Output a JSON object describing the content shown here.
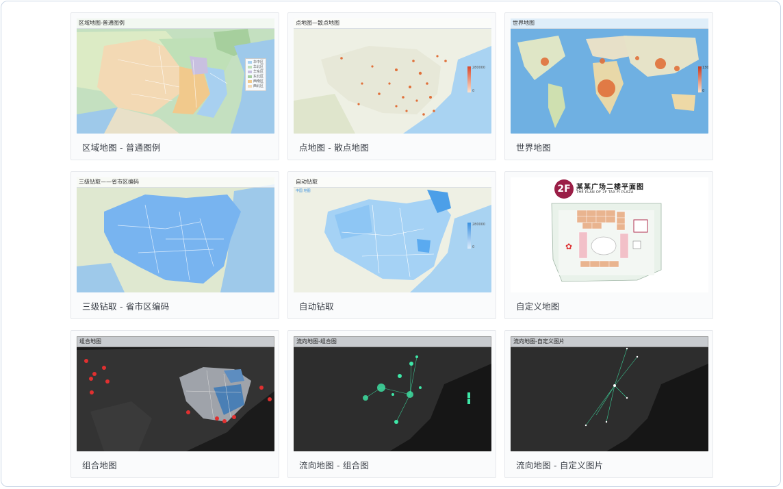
{
  "cards": [
    {
      "caption": "区域地图 - 普通图例",
      "thumb_title": "区域地图-普通图例",
      "legend": [
        "华中区",
        "华北区",
        "华东区",
        "东北区",
        "西南区",
        "西北区"
      ]
    },
    {
      "caption": "点地图 - 散点地图",
      "thumb_title": "点地图—散点地图",
      "scale_max": "280000",
      "scale_min": "0"
    },
    {
      "caption": "世界地图",
      "thumb_title": "世界地图",
      "scale_max": "130",
      "scale_min": "0"
    },
    {
      "caption": "三级钻取 - 省市区编码",
      "thumb_title": "三级钻取——省市区编码"
    },
    {
      "caption": "自动钻取",
      "thumb_title": "自动钻取",
      "thumb_subtitle": "中国 地图",
      "scale_max": "280000",
      "scale_min": "0"
    },
    {
      "caption": "自定义地图",
      "plan_badge": "2F",
      "plan_title": "某某广场二楼平面图",
      "plan_subtitle": "THE PLAN OF 2F TAX FI PLAZA"
    },
    {
      "caption": "组合地图",
      "thumb_title": "组合地图"
    },
    {
      "caption": "流向地图 - 组合图",
      "thumb_title": "流向地图-组合图"
    },
    {
      "caption": "流向地图 - 自定义图片",
      "thumb_title": "流向地图-自定义图片"
    }
  ],
  "colors": {
    "ocean_light": "#9ec9ea",
    "land_light": "#eee7d0",
    "china_blue": "#78b4f0",
    "dark_map": "#2a2a2a",
    "flow_green": "#3ee8a8",
    "marker_red": "#e03030"
  }
}
